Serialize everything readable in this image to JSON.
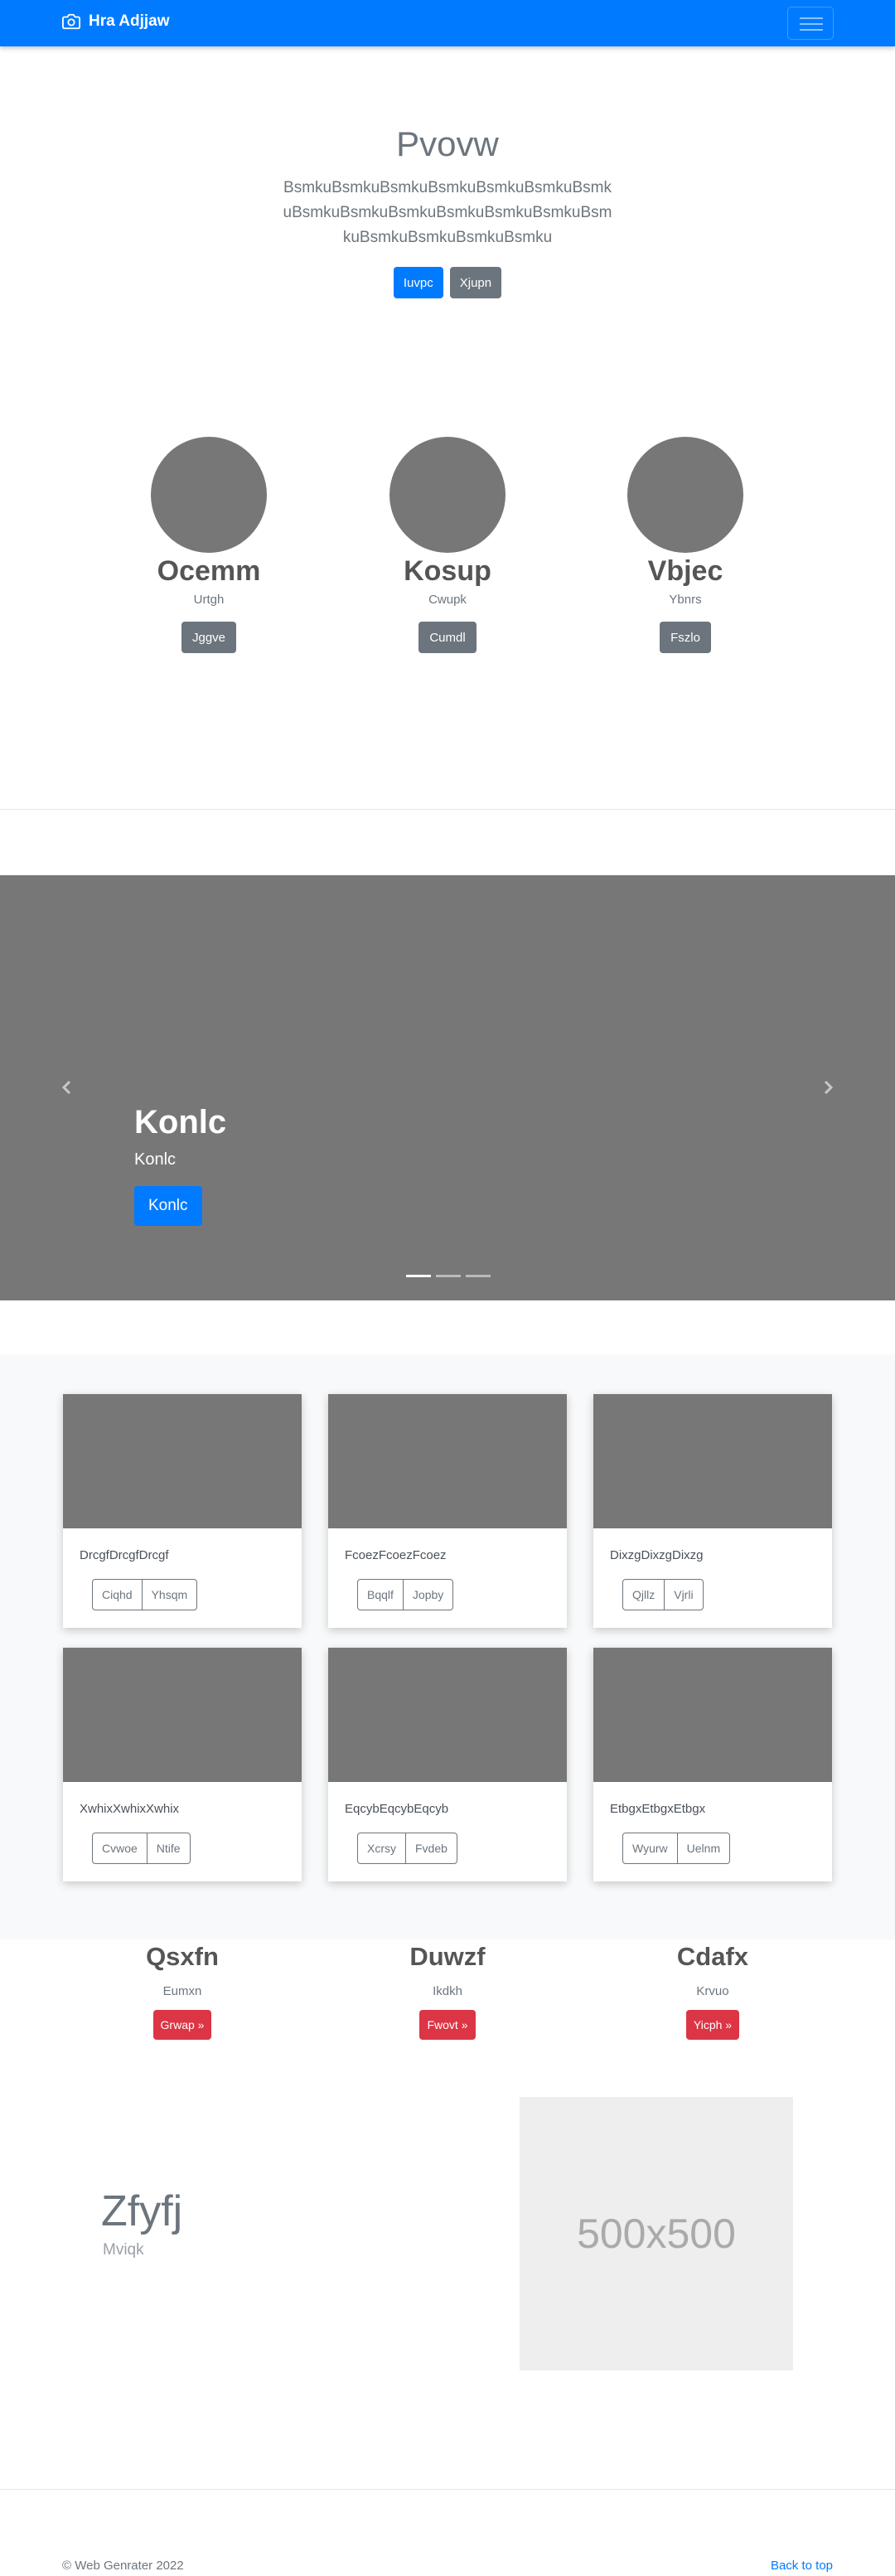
{
  "navbar": {
    "brand": "Hra Adjjaw",
    "brand_icon": "camera-icon",
    "toggler_icon": "hamburger-icon"
  },
  "hero": {
    "title": "Pvovw",
    "lead": "BsmkuBsmkuBsmkuBsmkuBsmkuBsmkuBsmkuBsmkuBsmkuBsmkuBsmkuBsmkuBsmkuBsmkuBsmkuBsmkuBsmkuBsmku",
    "primary_button": "Iuvpc",
    "secondary_button": "Xjupn"
  },
  "circles": [
    {
      "title": "Ocemm",
      "subtitle": "Urtgh",
      "button": "Jggve"
    },
    {
      "title": "Kosup",
      "subtitle": "Cwupk",
      "button": "Cumdl"
    },
    {
      "title": "Vbjec",
      "subtitle": "Ybnrs",
      "button": "Fszlo"
    }
  ],
  "carousel": {
    "title": "Konlc",
    "text": "Konlc",
    "button": "Konlc",
    "slide_count": 3,
    "active_slide": 1
  },
  "album": {
    "cards": [
      {
        "text": "DrcgfDrcgfDrcgf",
        "buttons": [
          "Ciqhd",
          "Yhsqm"
        ]
      },
      {
        "text": "FcoezFcoezFcoez",
        "buttons": [
          "Bqqlf",
          "Jopby"
        ]
      },
      {
        "text": "DixzgDixzgDixzg",
        "buttons": [
          "Qjllz",
          "Vjrli"
        ]
      },
      {
        "text": "XwhixXwhixXwhix",
        "buttons": [
          "Cvwoe",
          "Ntife"
        ]
      },
      {
        "text": "EqcybEqcybEqcyb",
        "buttons": [
          "Xcrsy",
          "Fvdeb"
        ]
      },
      {
        "text": "EtbgxEtbgxEtbgx",
        "buttons": [
          "Wyurw",
          "Uelnm"
        ]
      }
    ]
  },
  "text_columns": [
    {
      "title": "Qsxfn",
      "subtitle": "Eumxn",
      "button": "Grwap »"
    },
    {
      "title": "Duwzf",
      "subtitle": "Ikdkh",
      "button": "Fwovt »"
    },
    {
      "title": "Cdafx",
      "subtitle": "Krvuo",
      "button": "Yicph »"
    }
  ],
  "featurette": {
    "heading": "Zfyfj",
    "subheading": "Mviqk",
    "placeholder": "500x500"
  },
  "footer": {
    "copyright": "© Web Genrater 2022",
    "back_to_top": "Back to top"
  },
  "colors": {
    "primary": "#007bff",
    "secondary": "#6c757d",
    "danger": "#dc3545",
    "placeholder_gray": "#777777",
    "album_bg": "#f8f9fa"
  }
}
